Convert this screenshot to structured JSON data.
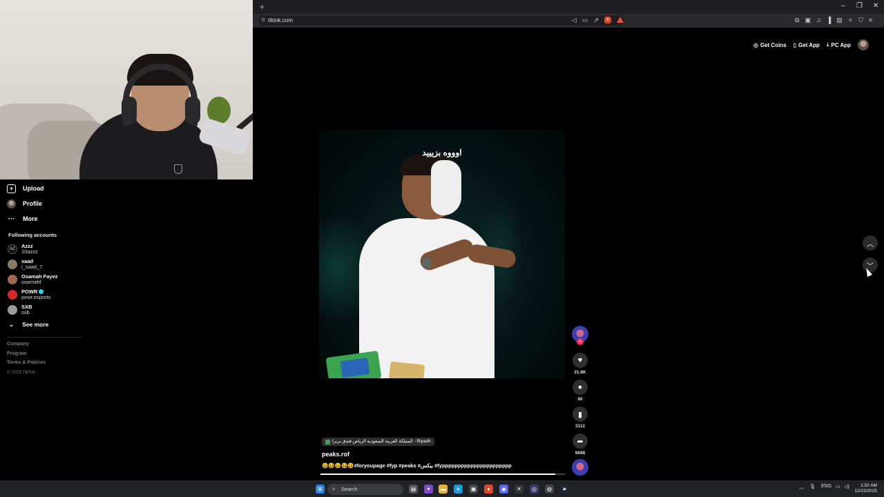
{
  "browser": {
    "new_tab_glyph": "+",
    "url": "tiktok.com",
    "window_controls": [
      "–",
      "❐",
      "✕"
    ]
  },
  "header": {
    "get_coins": "Get Coins",
    "get_app": "Get App",
    "pc_app": "PC App"
  },
  "sidebar": {
    "items": [
      {
        "label": "Upload",
        "icon": "plus-square-icon"
      },
      {
        "label": "Profile",
        "icon": "avatar-icon"
      },
      {
        "label": "More",
        "icon": "more-dots-icon"
      }
    ],
    "following_title": "Following accounts",
    "accounts": [
      {
        "name": "Azzz",
        "username": "10azzz",
        "color": "#c9c9c9",
        "verified": false
      },
      {
        "name": "saad",
        "username": "i_saad_7",
        "color": "#8c7a64",
        "verified": false
      },
      {
        "name": "Osamah Fayez",
        "username": "osamahf",
        "color": "#a06a52",
        "verified": false
      },
      {
        "name": "POWR",
        "username": "powr.esports",
        "color": "#d62828",
        "verified": true
      },
      {
        "name": "SXB",
        "username": "sxb",
        "color": "#9a9a9a",
        "verified": false
      }
    ],
    "see_more": "See more",
    "footer_links": [
      "Company",
      "Program",
      "Terms & Policies"
    ],
    "copyright": "© 2025 TikTok"
  },
  "video": {
    "caption_overlay": "اوووه بزيييد",
    "location": "المملكة العربية السعودية الرياض فندق بريرا - Riyadh",
    "author": "peaks.rof",
    "description": "😆😆😆😆😆#foryoupage #fyp #peaks #بيكس #fypppppppppppppppppppppp",
    "progress": 0.96,
    "likes": "21.8K",
    "comments": "90",
    "saves": "3112",
    "shares": "9898"
  },
  "taskbar": {
    "search_placeholder": "Search",
    "language": "ENG",
    "time": "1:50 AM",
    "date": "12/23/2025"
  },
  "colors": {
    "accent": "#fe2c55",
    "verified": "#20d5ec"
  }
}
